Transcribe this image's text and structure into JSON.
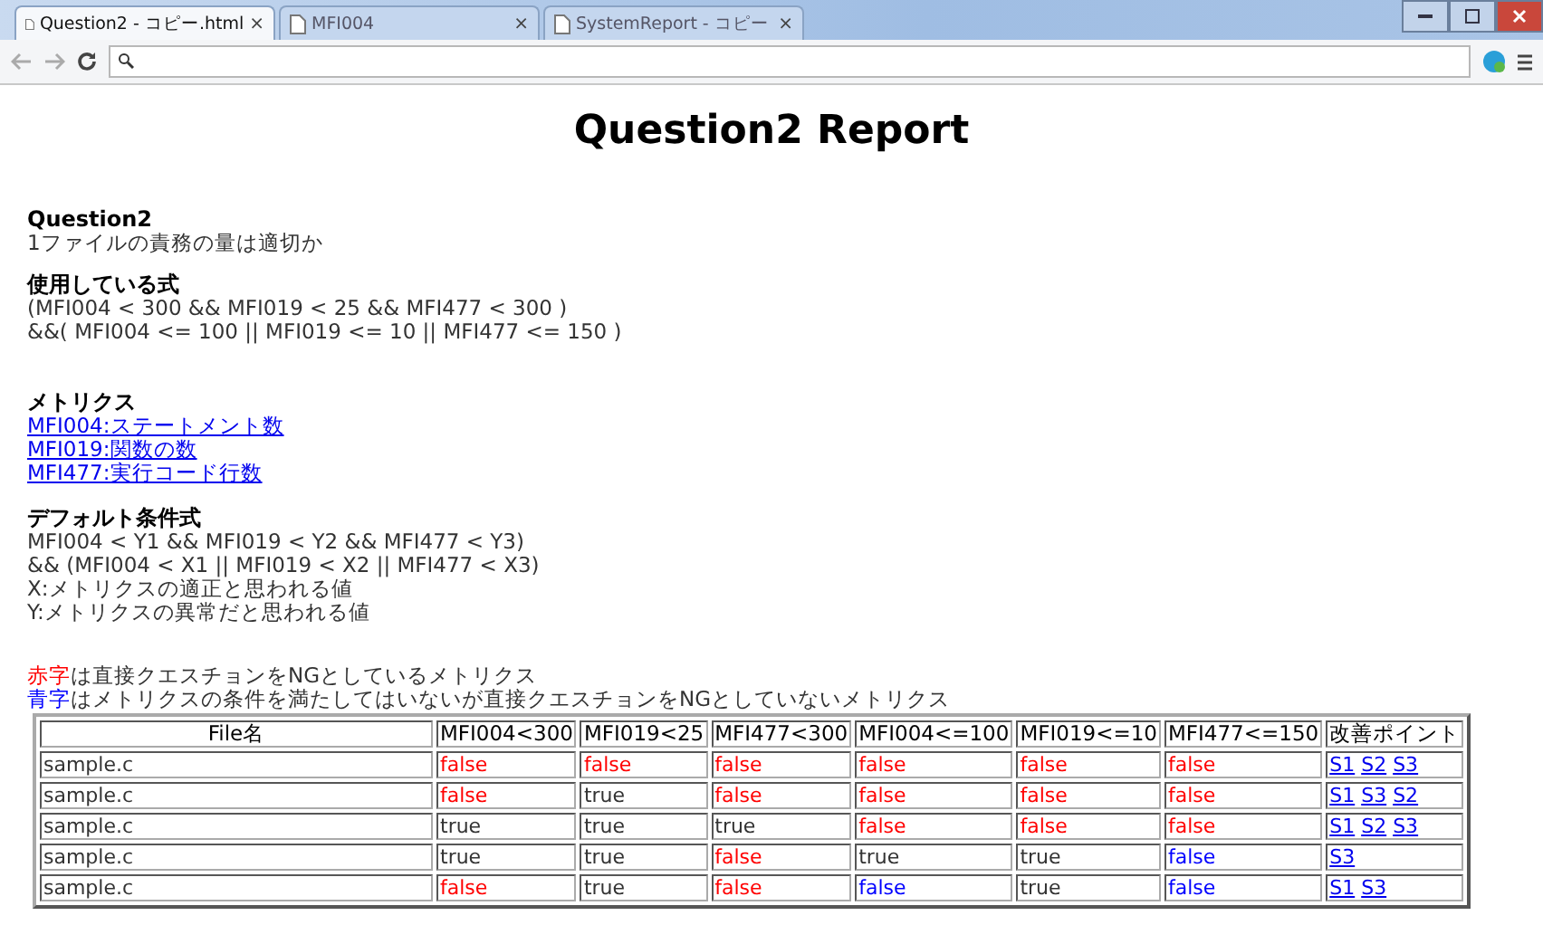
{
  "browser": {
    "tabs": [
      {
        "title": "Question2 - コピー.html",
        "selected": true
      },
      {
        "title": "MFI004",
        "selected": false
      },
      {
        "title": "SystemReport - コピー",
        "selected": false
      }
    ],
    "close_glyph": "×"
  },
  "page": {
    "title": "Question2 Report",
    "question": {
      "heading": "Question2",
      "text": "1ファイルの責務の量は適切か"
    },
    "formula": {
      "heading": "使用している式",
      "lines": [
        "(MFI004 < 300 && MFI019 < 25 && MFI477 < 300 )",
        "&&( MFI004 <= 100 || MFI019 <= 10 || MFI477 <= 150 )"
      ]
    },
    "metrics": {
      "heading": "メトリクス",
      "links": [
        "MFI004:ステートメント数",
        "MFI019:関数の数",
        "MFI477:実行コード行数"
      ]
    },
    "default_formula": {
      "heading": "デフォルト条件式",
      "lines": [
        "MFI004 < Y1 && MFI019 < Y2 && MFI477 < Y3)",
        "&& (MFI004 < X1 || MFI019 < X2 || MFI477 < X3)",
        "X:メトリクスの適正と思われる値",
        "Y:メトリクスの異常だと思われる値"
      ]
    },
    "legend": [
      {
        "key": "赤字",
        "text": "は直接クエスチョンをNGとしているメトリクス",
        "color": "#ff0000"
      },
      {
        "key": "青字",
        "text": "はメトリクスの条件を満たしてはいないが直接クエスチョンをNGとしていないメトリクス",
        "color": "#0000ff"
      }
    ],
    "table": {
      "columns": [
        "File名",
        "MFI004<300",
        "MFI019<25",
        "MFI477<300",
        "MFI004<=100",
        "MFI019<=10",
        "MFI477<=150",
        "改善ポイント"
      ],
      "rows": [
        {
          "cells": [
            {
              "kind": "text",
              "text": "sample.c",
              "color": "#333333"
            },
            {
              "kind": "text",
              "text": "false",
              "color": "#ff0000"
            },
            {
              "kind": "text",
              "text": "false",
              "color": "#ff0000"
            },
            {
              "kind": "text",
              "text": "false",
              "color": "#ff0000"
            },
            {
              "kind": "text",
              "text": "false",
              "color": "#ff0000"
            },
            {
              "kind": "text",
              "text": "false",
              "color": "#ff0000"
            },
            {
              "kind": "text",
              "text": "false",
              "color": "#ff0000"
            },
            {
              "kind": "links",
              "links": [
                "S1",
                "S2",
                "S3"
              ]
            }
          ]
        },
        {
          "cells": [
            {
              "kind": "text",
              "text": "sample.c",
              "color": "#333333"
            },
            {
              "kind": "text",
              "text": "false",
              "color": "#ff0000"
            },
            {
              "kind": "text",
              "text": "true",
              "color": "#333333"
            },
            {
              "kind": "text",
              "text": "false",
              "color": "#ff0000"
            },
            {
              "kind": "text",
              "text": "false",
              "color": "#ff0000"
            },
            {
              "kind": "text",
              "text": "false",
              "color": "#ff0000"
            },
            {
              "kind": "text",
              "text": "false",
              "color": "#ff0000"
            },
            {
              "kind": "links",
              "links": [
                "S1",
                "S3",
                "S2"
              ]
            }
          ]
        },
        {
          "cells": [
            {
              "kind": "text",
              "text": "sample.c",
              "color": "#333333"
            },
            {
              "kind": "text",
              "text": "true",
              "color": "#333333"
            },
            {
              "kind": "text",
              "text": "true",
              "color": "#333333"
            },
            {
              "kind": "text",
              "text": "true",
              "color": "#333333"
            },
            {
              "kind": "text",
              "text": "false",
              "color": "#ff0000"
            },
            {
              "kind": "text",
              "text": "false",
              "color": "#ff0000"
            },
            {
              "kind": "text",
              "text": "false",
              "color": "#ff0000"
            },
            {
              "kind": "links",
              "links": [
                "S1",
                "S2",
                "S3"
              ]
            }
          ]
        },
        {
          "cells": [
            {
              "kind": "text",
              "text": "sample.c",
              "color": "#333333"
            },
            {
              "kind": "text",
              "text": "true",
              "color": "#333333"
            },
            {
              "kind": "text",
              "text": "true",
              "color": "#333333"
            },
            {
              "kind": "text",
              "text": "false",
              "color": "#ff0000"
            },
            {
              "kind": "text",
              "text": "true",
              "color": "#333333"
            },
            {
              "kind": "text",
              "text": "true",
              "color": "#333333"
            },
            {
              "kind": "text",
              "text": "false",
              "color": "#0000ff"
            },
            {
              "kind": "links",
              "links": [
                "S3"
              ]
            }
          ]
        },
        {
          "cells": [
            {
              "kind": "text",
              "text": "sample.c",
              "color": "#333333"
            },
            {
              "kind": "text",
              "text": "false",
              "color": "#ff0000"
            },
            {
              "kind": "text",
              "text": "true",
              "color": "#333333"
            },
            {
              "kind": "text",
              "text": "false",
              "color": "#ff0000"
            },
            {
              "kind": "text",
              "text": "false",
              "color": "#0000ff"
            },
            {
              "kind": "text",
              "text": "true",
              "color": "#333333"
            },
            {
              "kind": "text",
              "text": "false",
              "color": "#0000ff"
            },
            {
              "kind": "links",
              "links": [
                "S1",
                "S3"
              ]
            }
          ]
        }
      ]
    }
  }
}
